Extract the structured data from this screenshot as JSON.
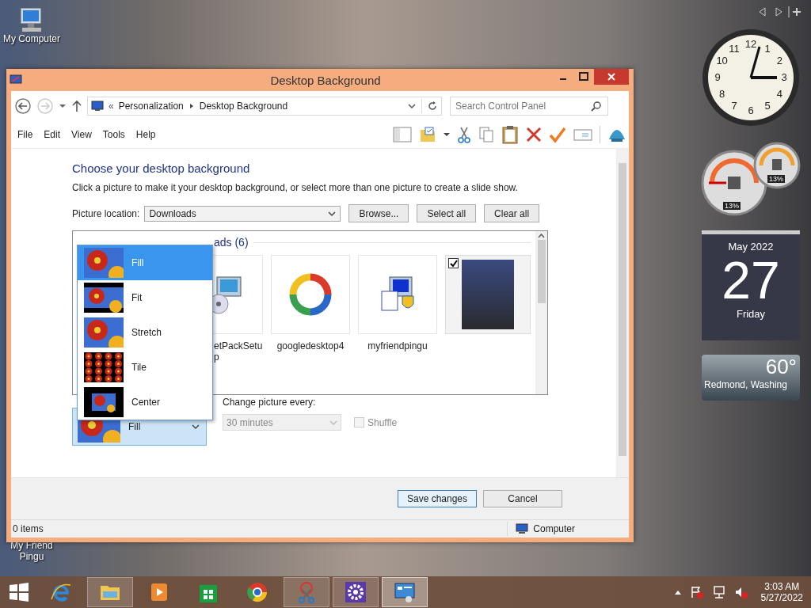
{
  "desktop_icons": [
    {
      "label": "My Computer",
      "kind": "computer"
    },
    {
      "label": "My Friend Pingu",
      "kind": "installer"
    }
  ],
  "window": {
    "title": "Desktop Background",
    "address": {
      "overflow_mark": "«",
      "crumbs": [
        "Personalization",
        "Desktop Background"
      ]
    },
    "search": {
      "placeholder": "Search Control Panel"
    },
    "menu": [
      "File",
      "Edit",
      "View",
      "Tools",
      "Help"
    ],
    "heading": "Choose your desktop background",
    "description": "Click a picture to make it your desktop background, or select more than one picture to create a slide show.",
    "picture_location": {
      "label": "Picture location:",
      "value": "Downloads"
    },
    "buttons": [
      "Browse...",
      "Select all",
      "Clear all"
    ],
    "group_heading": "ads (6)",
    "pictures": [
      {
        "label": "etPackSetup",
        "kind": "installer-disc",
        "checked": false
      },
      {
        "label": "googledesktop4",
        "kind": "swirl",
        "checked": false
      },
      {
        "label": "myfriendpingu",
        "kind": "installer",
        "checked": false
      },
      {
        "kind": "photo",
        "checked": true
      }
    ],
    "position_options": [
      {
        "label": "Fill",
        "kind": "fill",
        "selected": true
      },
      {
        "label": "Fit",
        "kind": "fit",
        "selected": false
      },
      {
        "label": "Stretch",
        "kind": "stretch",
        "selected": false
      },
      {
        "label": "Tile",
        "kind": "tile",
        "selected": false
      },
      {
        "label": "Center",
        "kind": "center",
        "selected": false
      }
    ],
    "position_value": "Fill",
    "change_label": "Change picture every:",
    "change_value": "30 minutes",
    "shuffle": {
      "label": "Shuffle",
      "checked": false,
      "disabled": true
    },
    "footer_buttons": [
      {
        "label": "Save changes",
        "default": true
      },
      {
        "label": "Cancel",
        "default": false
      }
    ],
    "status": {
      "items": "0 items",
      "location": "Computer"
    }
  },
  "gadgets": {
    "clock_numerals": [
      "11",
      "12",
      "1",
      "10",
      "2",
      "9",
      "3",
      "8",
      "4",
      "7",
      "6",
      "5"
    ],
    "cpu_readings": [
      "13%",
      "13%"
    ],
    "calendar": {
      "month": "May 2022",
      "day": "27",
      "weekday": "Friday"
    },
    "weather": {
      "temperature": "60°",
      "city": "Redmond, Washing"
    }
  },
  "taskbar": {
    "apps": [
      {
        "kind": "ie",
        "running": false,
        "selected": false
      },
      {
        "kind": "folder",
        "running": true,
        "selected": false
      },
      {
        "kind": "media",
        "running": false,
        "selected": false
      },
      {
        "kind": "store",
        "running": false,
        "selected": false
      },
      {
        "kind": "chrome",
        "running": false,
        "selected": false
      },
      {
        "kind": "scissors",
        "running": true,
        "selected": false
      },
      {
        "kind": "gear",
        "running": true,
        "selected": false
      },
      {
        "kind": "panel",
        "running": true,
        "selected": true
      }
    ],
    "time": "3:03 AM",
    "date": "5/27/2022"
  }
}
